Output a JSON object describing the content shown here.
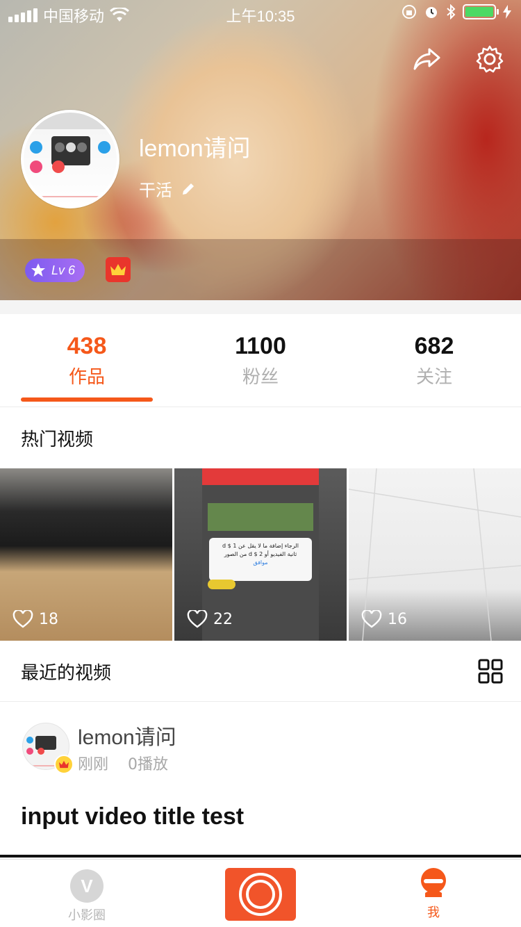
{
  "status_bar": {
    "carrier": "中国移动",
    "time": "上午10:35"
  },
  "profile": {
    "name": "lemon请问",
    "bio": "干活",
    "level": "Lv 6"
  },
  "stats": [
    {
      "value": "438",
      "label": "作品",
      "active": true
    },
    {
      "value": "1100",
      "label": "粉丝",
      "active": false
    },
    {
      "value": "682",
      "label": "关注",
      "active": false
    }
  ],
  "hot": {
    "title": "热门视频",
    "videos": [
      {
        "likes": "18"
      },
      {
        "likes": "22"
      },
      {
        "likes": "16"
      }
    ]
  },
  "recent": {
    "title": "最近的视频",
    "post": {
      "author": "lemon请问",
      "time": "刚刚",
      "plays": "0播放",
      "title": "input video title test"
    }
  },
  "nav": {
    "left_label": "小影圈",
    "right_label": "我"
  },
  "colors": {
    "accent": "#f5581a",
    "level_badge": "#8a62f1",
    "crown": "#e9352c"
  },
  "icons": [
    "share-icon",
    "settings-icon",
    "edit-icon",
    "heart-icon",
    "grid-icon",
    "crown-icon",
    "record-icon"
  ]
}
